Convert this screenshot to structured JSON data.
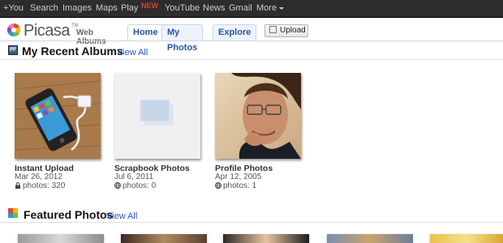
{
  "gbar": {
    "items": [
      "+You",
      "Search",
      "Images",
      "Maps",
      "Play",
      "YouTube",
      "News",
      "Gmail",
      "More"
    ],
    "play_badge": "NEW"
  },
  "header": {
    "brand": "Picasa",
    "tm": "TM",
    "subtitle": "Web Albums",
    "tabs": [
      "Home",
      "My Photos",
      "Explore"
    ],
    "active_tab": "Home",
    "upload_label": "Upload"
  },
  "recent": {
    "title": "My Recent Albums",
    "view_all": "View All",
    "albums": [
      {
        "title": "Instant Upload",
        "date": "Mar 26, 2012",
        "count": "photos: 320",
        "visibility": "lock-icon"
      },
      {
        "title": "Scrapbook Photos",
        "date": "Jul 6, 2011",
        "count": "photos: 0",
        "visibility": "globe-icon"
      },
      {
        "title": "Profile Photos",
        "date": "Apr 12, 2005",
        "count": "photos: 1",
        "visibility": "globe-icon"
      }
    ]
  },
  "featured": {
    "title": "Featured Photos",
    "view_all": "View All"
  },
  "colors": {
    "gbar_bg": "#2d2d2d",
    "link": "#2255cc",
    "new_badge": "#e03b2e"
  }
}
